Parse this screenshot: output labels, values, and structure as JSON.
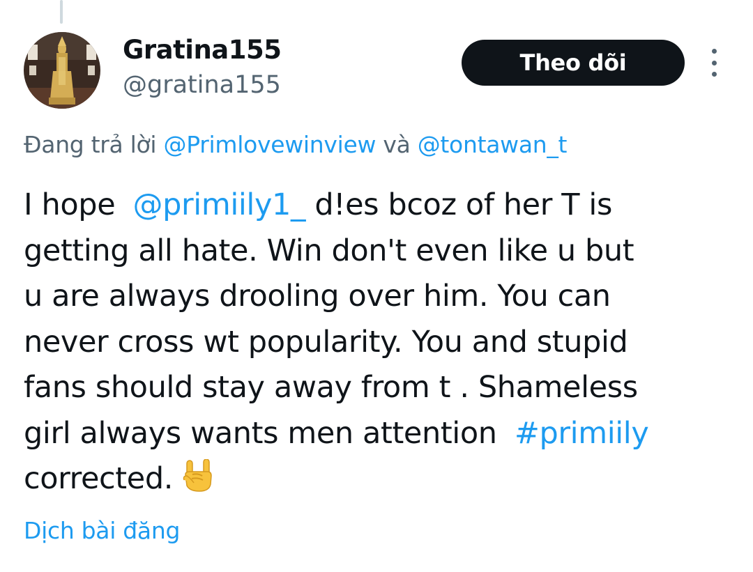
{
  "author": {
    "display_name": "Gratina155",
    "handle": "@gratina155",
    "avatar_icon": "golden-statue-avatar"
  },
  "actions": {
    "follow_label": "Theo dõi",
    "more_icon": "more-vertical-icon"
  },
  "reply_context": {
    "prefix": "Đang trả lời",
    "mention_1": "@Primlovewinview",
    "connector": "và",
    "mention_2": "@tontawan_t"
  },
  "tweet": {
    "line_1_pre": "I hope ",
    "line_1_mention": "@primiily1_",
    "line_1_post": " d!es bcoz of her T is",
    "line_2": "getting all hate. Win don't even like u but",
    "line_3": "u are always drooling over him. You can",
    "line_4": "never cross wt popularity. You and stupid",
    "line_5": "fans should stay away from t . Shameless",
    "line_6_pre": "girl always wants men attention ",
    "line_6_hashtag": "#primiily",
    "line_7": "corrected.",
    "emoji_icon": "sign-of-the-horns-emoji"
  },
  "translate_label": "Dịch bài đăng",
  "colors": {
    "link": "#1d9bf0",
    "secondary_text": "#536471",
    "primary_text": "#0f1419",
    "button_bg": "#0f1419"
  }
}
